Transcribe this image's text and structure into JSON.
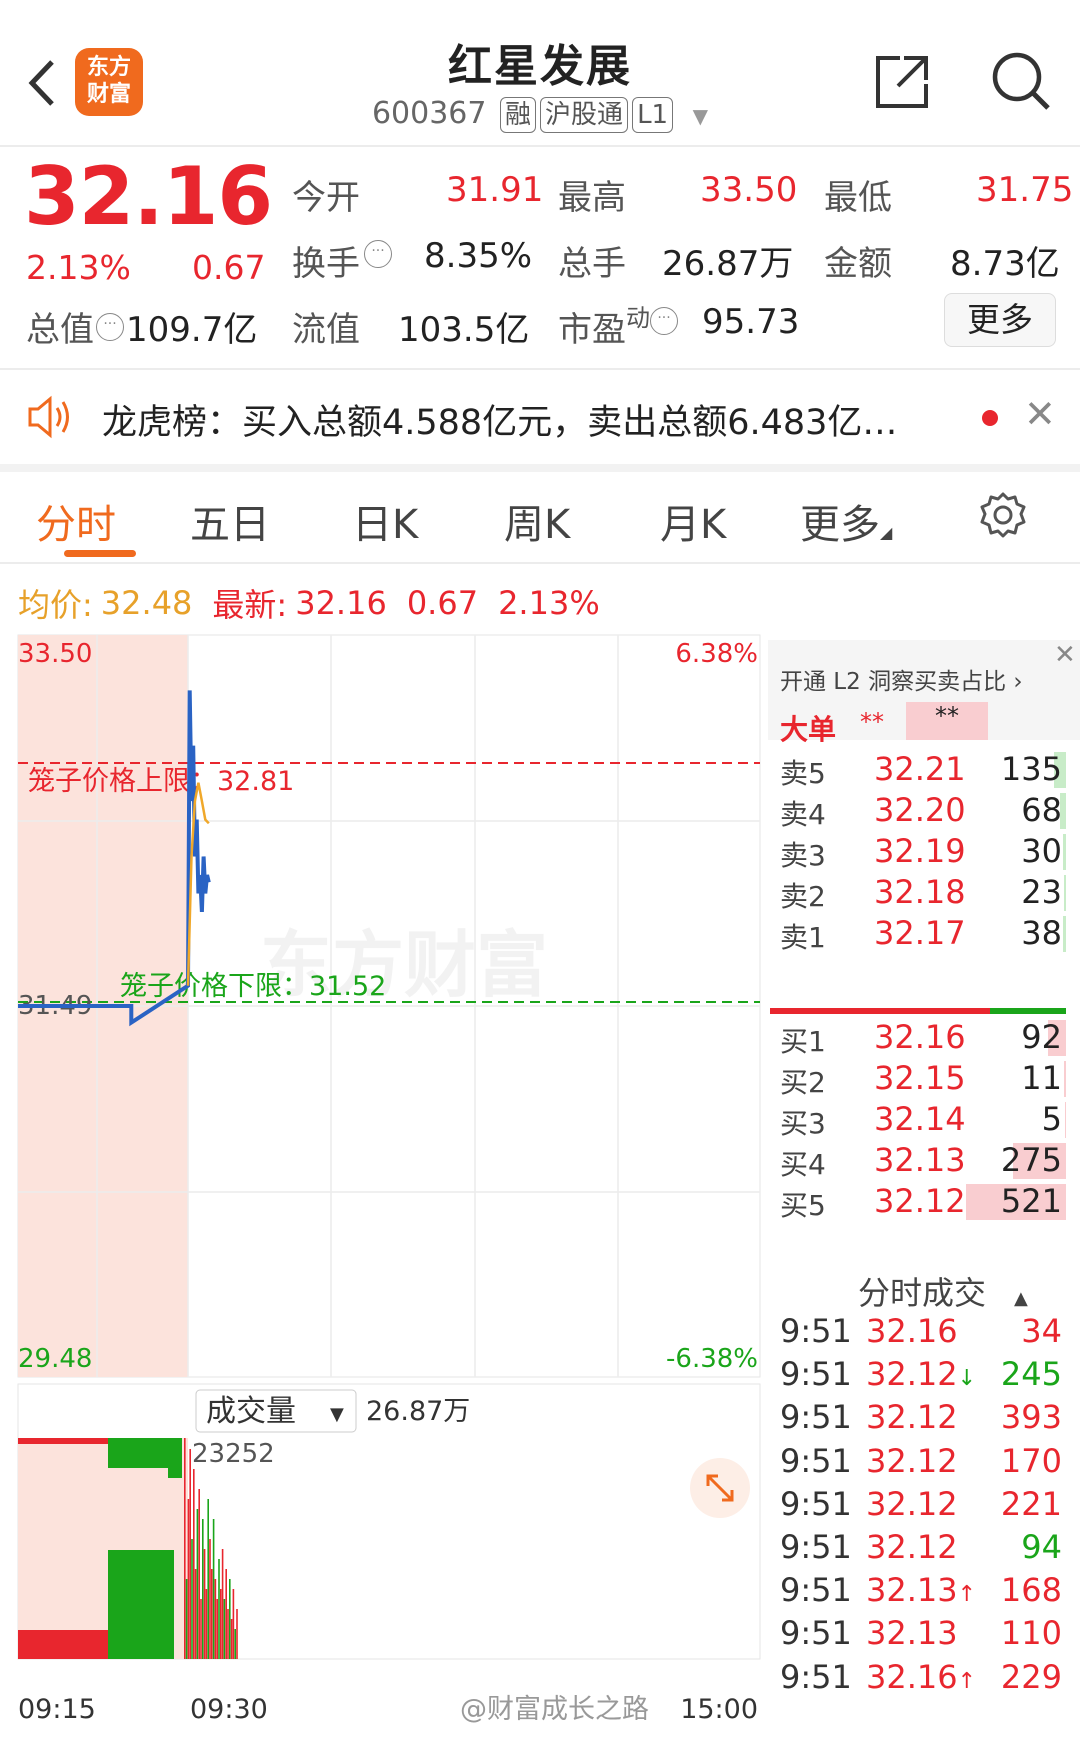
{
  "header": {
    "title": "红星发展",
    "code": "600367",
    "tags": [
      "融",
      "沪股通",
      "L1"
    ],
    "logo_text_1": "东方",
    "logo_text_2": "财富"
  },
  "quote": {
    "price": "32.16",
    "change_pct": "2.13%",
    "change": "0.67",
    "open_label": "今开",
    "open": "31.91",
    "high_label": "最高",
    "high": "33.50",
    "low_label": "最低",
    "low": "31.75",
    "turnover_label": "换手",
    "turnover": "8.35%",
    "volume_label": "总手",
    "volume": "26.87万",
    "amount_label": "金额",
    "amount": "8.73亿",
    "mcap_label": "总值",
    "mcap": "109.7亿",
    "float_label": "流值",
    "float": "103.5亿",
    "pe_label": "市盈",
    "pe_sup": "动",
    "pe": "95.73",
    "more": "更多"
  },
  "notice": {
    "text": "龙虎榜：买入总额4.588亿元，卖出总额6.483亿…"
  },
  "tabs": [
    "分时",
    "五日",
    "日K",
    "周K",
    "月K",
    "更多"
  ],
  "info_bar": {
    "avg_label": "均价:",
    "avg": "32.48",
    "latest_label": "最新:",
    "latest": "32.16",
    "chg": "0.67",
    "chg_pct": "2.13%"
  },
  "chart": {
    "y_top": "33.50",
    "y_bottom": "29.48",
    "pct_top": "6.38%",
    "pct_bottom": "-6.38%",
    "y_mid_label": "31.49",
    "cage_upper_label": "笼子价格上限：",
    "cage_upper": "32.81",
    "cage_lower_label": "笼子价格下限：",
    "cage_lower": "31.52",
    "watermark": "东方财富",
    "vol_selector": "成交量",
    "vol_total": "26.87万",
    "vol_peak": "23252",
    "x_start": "09:15",
    "x_mid": "09:30",
    "x_end": "15:00",
    "credit": "@财富成长之路"
  },
  "chart_data": {
    "type": "line",
    "ylim": [
      29.48,
      33.5
    ],
    "series": [
      {
        "name": "最新",
        "x": [
          "09:15",
          "09:25",
          "09:25",
          "09:30",
          "09:31",
          "09:32",
          "09:33",
          "09:34",
          "09:35",
          "09:36",
          "09:37",
          "09:38",
          "09:39",
          "09:40",
          "09:41",
          "09:42"
        ],
        "values": [
          31.49,
          31.49,
          31.4,
          31.6,
          33.2,
          32.6,
          32.9,
          32.3,
          32.5,
          32.1,
          32.2,
          32.0,
          32.3,
          32.1,
          32.2,
          32.16
        ]
      },
      {
        "name": "均价",
        "x": [
          "09:30",
          "09:32",
          "09:34",
          "09:36",
          "09:38",
          "09:40",
          "09:42"
        ],
        "values": [
          31.6,
          32.3,
          32.6,
          32.7,
          32.6,
          32.5,
          32.48
        ]
      }
    ]
  },
  "orderbook": {
    "promo": "开通 L2 洞察买卖占比",
    "big_label": "大单",
    "big_val": "**",
    "big_val2": "**",
    "sells": [
      {
        "label": "卖5",
        "price": "32.21",
        "vol": "135"
      },
      {
        "label": "卖4",
        "price": "32.20",
        "vol": "68"
      },
      {
        "label": "卖3",
        "price": "32.19",
        "vol": "30"
      },
      {
        "label": "卖2",
        "price": "32.18",
        "vol": "23"
      },
      {
        "label": "卖1",
        "price": "32.17",
        "vol": "38"
      }
    ],
    "buys": [
      {
        "label": "买1",
        "price": "32.16",
        "vol": "92"
      },
      {
        "label": "买2",
        "price": "32.15",
        "vol": "11"
      },
      {
        "label": "买3",
        "price": "32.14",
        "vol": "5"
      },
      {
        "label": "买4",
        "price": "32.13",
        "vol": "275"
      },
      {
        "label": "买5",
        "price": "32.12",
        "vol": "521"
      }
    ],
    "trades_title": "分时成交",
    "trades": [
      {
        "time": "9:51",
        "price": "32.16",
        "arrow": "",
        "vol": "34",
        "color": "red"
      },
      {
        "time": "9:51",
        "price": "32.12",
        "arrow": "↓",
        "vol": "245",
        "color": "green"
      },
      {
        "time": "9:51",
        "price": "32.12",
        "arrow": "",
        "vol": "393",
        "color": "red"
      },
      {
        "time": "9:51",
        "price": "32.12",
        "arrow": "",
        "vol": "170",
        "color": "red"
      },
      {
        "time": "9:51",
        "price": "32.12",
        "arrow": "",
        "vol": "221",
        "color": "red"
      },
      {
        "time": "9:51",
        "price": "32.12",
        "arrow": "",
        "vol": "94",
        "color": "green"
      },
      {
        "time": "9:51",
        "price": "32.13",
        "arrow": "↑",
        "vol": "168",
        "color": "red"
      },
      {
        "time": "9:51",
        "price": "32.13",
        "arrow": "",
        "vol": "110",
        "color": "red"
      },
      {
        "time": "9:51",
        "price": "32.16",
        "arrow": "↑",
        "vol": "229",
        "color": "red"
      }
    ]
  }
}
